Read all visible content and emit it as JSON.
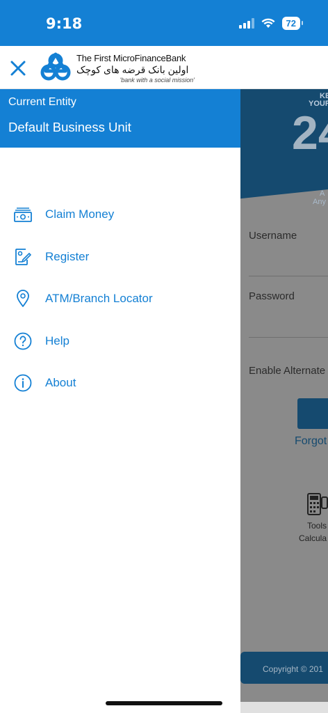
{
  "status_bar": {
    "time": "9:18",
    "battery": "72"
  },
  "header": {
    "logo_en": "The First MicroFinanceBank",
    "logo_fa": "اولین بانک قرضه های کوچک",
    "logo_tagline": "'bank with a social mission'"
  },
  "drawer": {
    "entity_label": "Current Entity",
    "entity_value": "Default Business Unit",
    "items": [
      {
        "label": "Claim Money",
        "icon": "money-icon"
      },
      {
        "label": "Register",
        "icon": "register-form-icon"
      },
      {
        "label": "ATM/Branch Locator",
        "icon": "location-pin-icon"
      },
      {
        "label": "Help",
        "icon": "question-circle-icon"
      },
      {
        "label": "About",
        "icon": "info-circle-icon"
      }
    ]
  },
  "background": {
    "banner_line1": "KE",
    "banner_line2": "YOUR",
    "banner_big": "24",
    "banner_line3": "A",
    "banner_line4": "Any",
    "username_label": "Username",
    "password_label": "Password",
    "alternate_label": "Enable Alternate",
    "forgot_label": "Forgot",
    "tools_line1": "Tools",
    "tools_line2": "Calcula",
    "copyright": "Copyright © 201"
  },
  "colors": {
    "primary": "#1480d4",
    "dark": "#154a6f",
    "overlay": "#8a8a8a"
  }
}
